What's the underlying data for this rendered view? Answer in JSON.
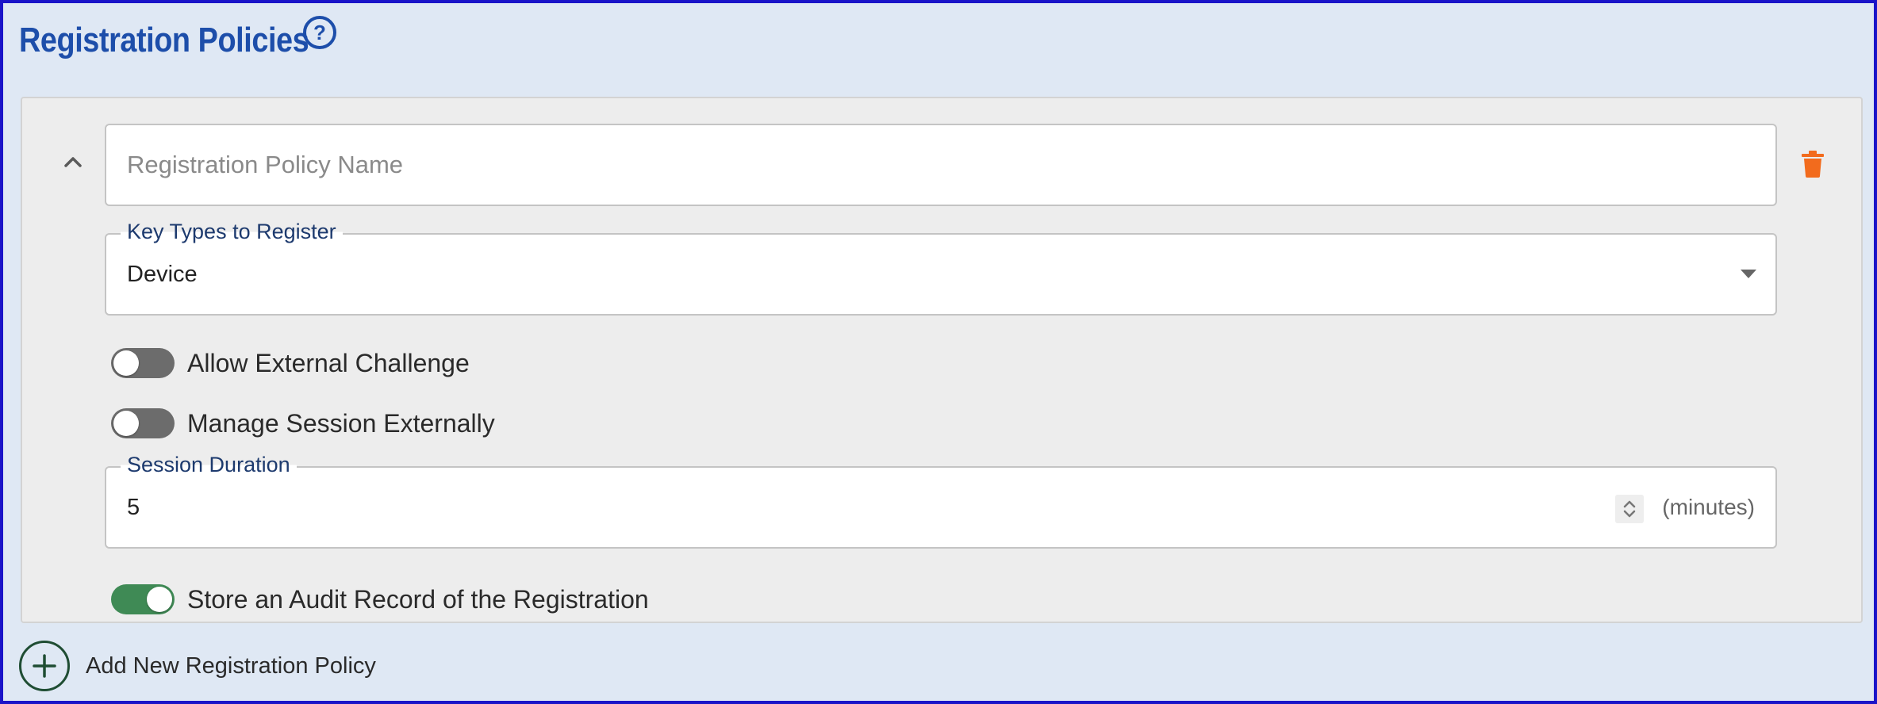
{
  "header": {
    "title": "Registration Policies",
    "help_icon": "question-circle-icon",
    "help_label": "?"
  },
  "policy": {
    "name_field": {
      "value": "",
      "placeholder": "Registration Policy Name"
    },
    "key_types": {
      "label": "Key Types to Register",
      "selected": "Device"
    },
    "allow_external_challenge": {
      "label": "Allow External Challenge",
      "enabled": false
    },
    "manage_session_externally": {
      "label": "Manage Session Externally",
      "enabled": false
    },
    "session_duration": {
      "label": "Session Duration",
      "value": "5",
      "units": "(minutes)"
    },
    "store_audit_record": {
      "label": "Store an Audit Record of the Registration",
      "enabled": true
    },
    "collapse_icon": "chevron-up-icon",
    "delete_icon": "trash-icon"
  },
  "add_policy": {
    "label": "Add New Registration Policy",
    "icon": "plus-circle-icon"
  },
  "colors": {
    "background": "#dfe8f4",
    "border": "#1a14c8",
    "title": "#1d4eaa",
    "delete": "#f26b1d",
    "toggle_on": "#3f8a55",
    "toggle_off": "#6c6c6c",
    "add_icon": "#1f4d33"
  }
}
